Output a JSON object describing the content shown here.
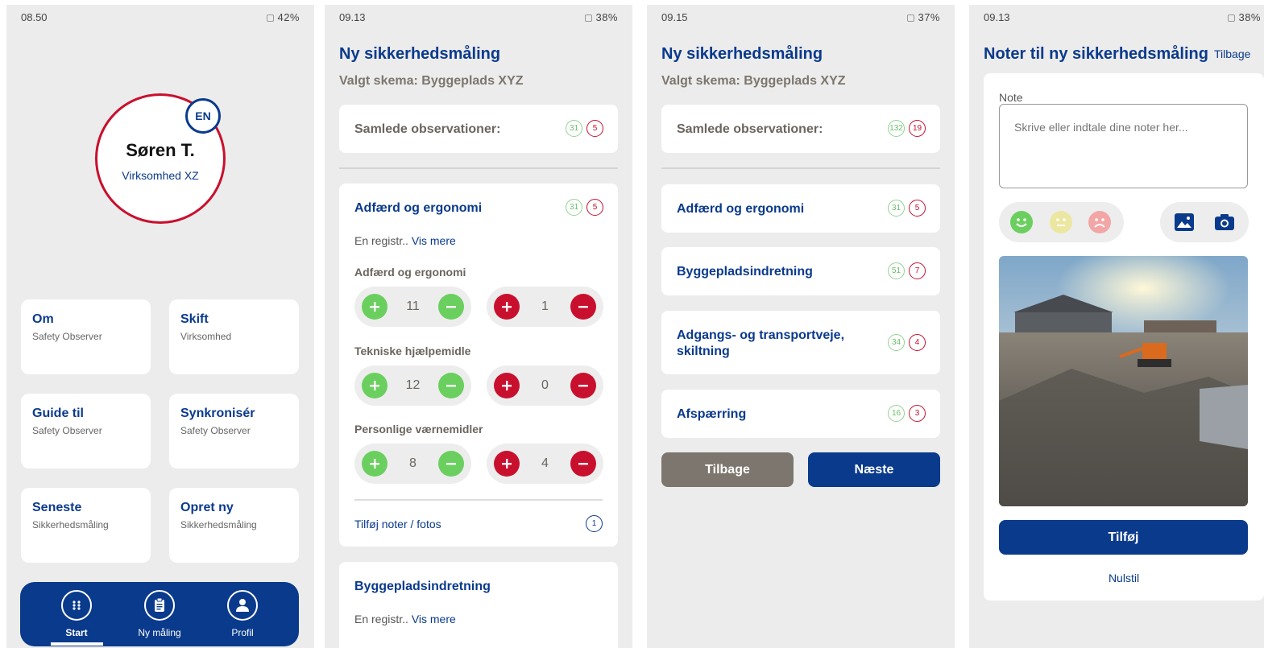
{
  "colors": {
    "brand_blue": "#0a3a8c",
    "brand_red": "#c8102e",
    "positive_green": "#6bcf5f",
    "muted_brown": "#7d766e"
  },
  "screen1": {
    "status": {
      "time": "08.50",
      "battery": "42%"
    },
    "profile": {
      "name": "Søren T.",
      "company": "Virksomhed XZ",
      "language": "EN"
    },
    "tiles": [
      {
        "title": "Om",
        "subtitle": "Safety Observer"
      },
      {
        "title": "Skift",
        "subtitle": "Virksomhed"
      },
      {
        "title": "Guide til",
        "subtitle": "Safety Observer"
      },
      {
        "title": "Synkronisér",
        "subtitle": "Safety Observer"
      },
      {
        "title": "Seneste",
        "subtitle": "Sikkerhedsmåling"
      },
      {
        "title": "Opret ny",
        "subtitle": "Sikkerhedsmåling"
      }
    ],
    "nav": [
      {
        "label": "Start",
        "icon": "grid-icon"
      },
      {
        "label": "Ny måling",
        "icon": "clipboard-icon"
      },
      {
        "label": "Profil",
        "icon": "user-icon"
      }
    ]
  },
  "screen2": {
    "status": {
      "time": "09.13",
      "battery": "38%"
    },
    "title": "Ny sikkerhedsmåling",
    "subtitle": "Valgt skema: Byggeplads XYZ",
    "total": {
      "label": "Samlede observationer:",
      "positive": "31",
      "negative": "5"
    },
    "section": {
      "title": "Adfærd og ergonomi",
      "positive": "31",
      "negative": "5",
      "desc": "En registr..",
      "more": "Vis mere",
      "rows": [
        {
          "label": "Adfærd og ergonomi",
          "positive": "11",
          "negative": "1"
        },
        {
          "label": "Tekniske hjælpemidle",
          "positive": "12",
          "negative": "0"
        },
        {
          "label": "Personlige værnemidler",
          "positive": "8",
          "negative": "4"
        }
      ],
      "add_note": "Tilføj noter / fotos",
      "note_count": "1"
    },
    "next_section": {
      "title": "Byggepladsindretning",
      "desc": "En registr..",
      "more": "Vis mere"
    }
  },
  "screen3": {
    "status": {
      "time": "09.15",
      "battery": "37%"
    },
    "title": "Ny sikkerhedsmåling",
    "subtitle": "Valgt skema: Byggeplads XYZ",
    "total": {
      "label": "Samlede observationer:",
      "positive": "132",
      "negative": "19"
    },
    "sections": [
      {
        "title": "Adfærd og ergonomi",
        "positive": "31",
        "negative": "5"
      },
      {
        "title": "Byggepladsindretning",
        "positive": "51",
        "negative": "7"
      },
      {
        "title": "Adgangs- og transportveje, skiltning",
        "positive": "34",
        "negative": "4"
      },
      {
        "title": "Afspærring",
        "positive": "16",
        "negative": "3"
      }
    ],
    "back_label": "Tilbage",
    "next_label": "Næste"
  },
  "screen4": {
    "status": {
      "time": "09.13",
      "battery": "38%"
    },
    "title": "Noter til ny sikkerhedsmåling",
    "back_label": "Tilbage",
    "note_label": "Note",
    "note_placeholder": "Skrive eller indtale dine noter her...",
    "add_label": "Tilføj",
    "reset_label": "Nulstil"
  }
}
